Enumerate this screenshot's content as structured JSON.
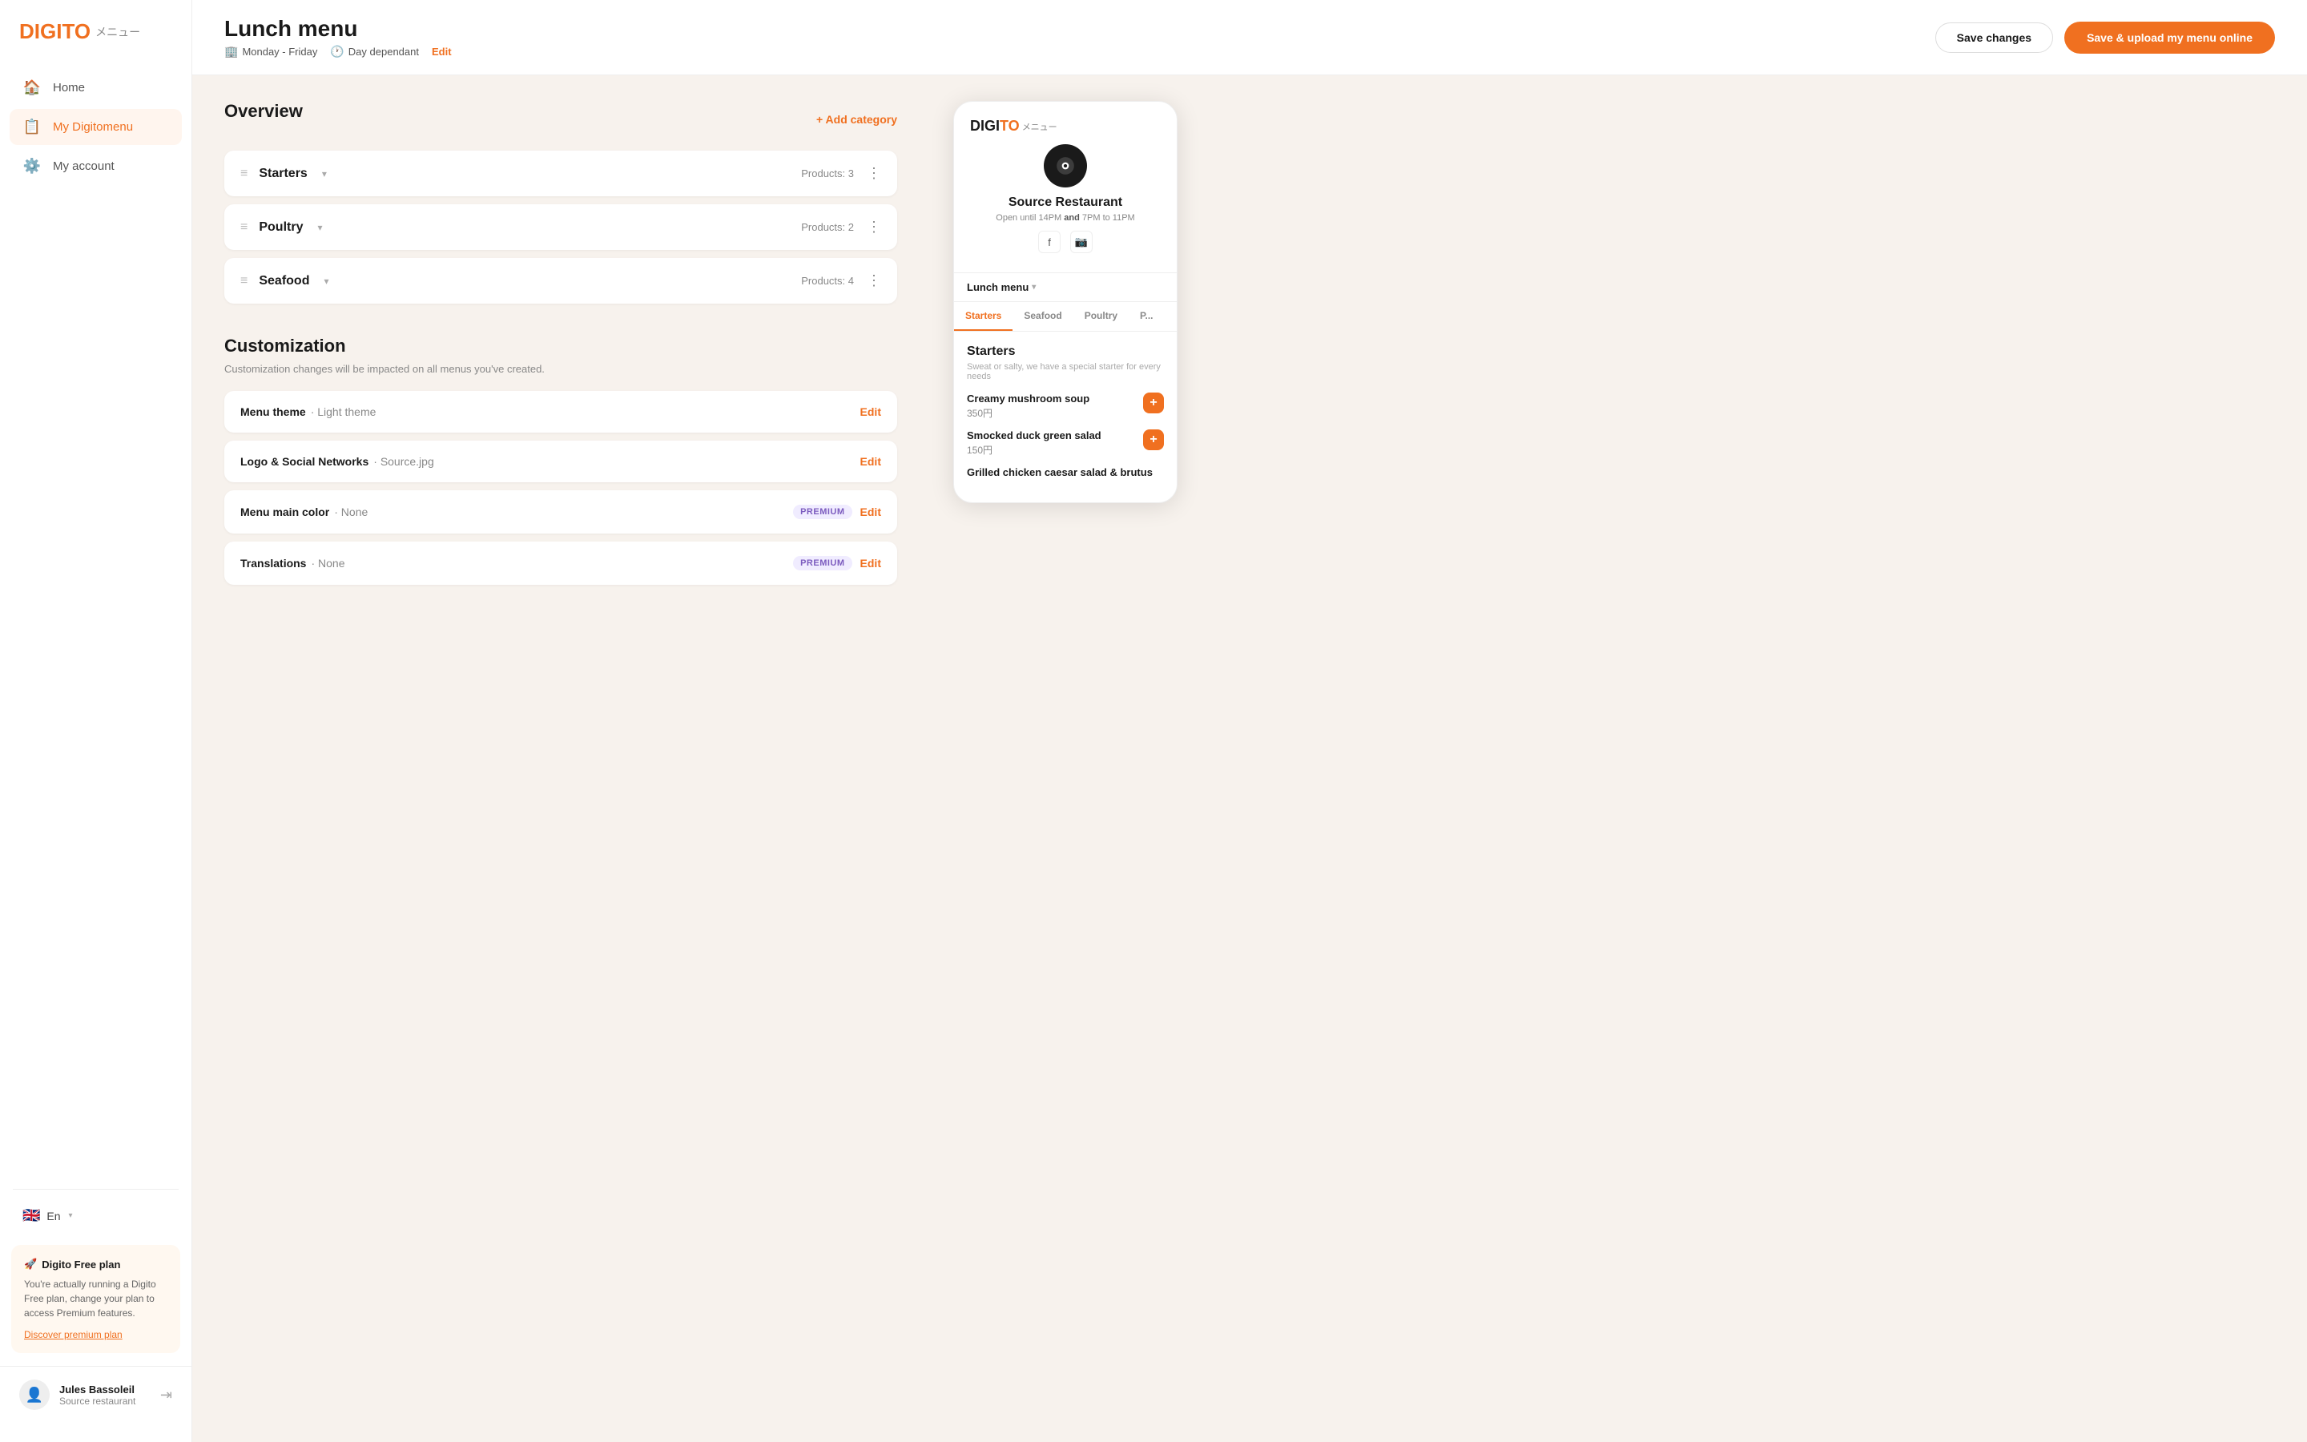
{
  "brand": {
    "name_black": "DIGITO",
    "name_orange": "",
    "name_jp": "メニュー",
    "logo_text": "DIGI",
    "logo_orange": "TO"
  },
  "sidebar": {
    "nav_items": [
      {
        "id": "home",
        "label": "Home",
        "icon": "🏠",
        "active": false
      },
      {
        "id": "my-digitomenu",
        "label": "My Digitomenu",
        "icon": "📋",
        "active": true
      },
      {
        "id": "my-account",
        "label": "My account",
        "icon": "⚙️",
        "active": false
      }
    ],
    "language": {
      "flag": "🇬🇧",
      "label": "En",
      "chevron": "▾"
    },
    "promo": {
      "emoji": "🚀",
      "title": "Digito Free plan",
      "description": "You're actually running a Digito Free plan, change your plan to access Premium features.",
      "link_text": "Discover premium plan"
    },
    "user": {
      "name": "Jules Bassoleil",
      "restaurant": "Source restaurant",
      "avatar_icon": "👤",
      "logout_icon": "→"
    }
  },
  "header": {
    "menu_title": "Lunch menu",
    "meta_schedule": "Monday - Friday",
    "meta_schedule_icon": "🏢",
    "meta_timing": "Day dependant",
    "meta_timing_icon": "🕐",
    "edit_label": "Edit",
    "save_changes_label": "Save changes",
    "save_upload_label": "Save & upload my menu online"
  },
  "overview": {
    "title": "Overview",
    "add_category_label": "+ Add category",
    "categories": [
      {
        "id": "starters",
        "name": "Starters",
        "products_count": "Products: 3"
      },
      {
        "id": "poultry",
        "name": "Poultry",
        "products_count": "Products: 2"
      },
      {
        "id": "seafood",
        "name": "Seafood",
        "products_count": "Products: 4"
      }
    ]
  },
  "customization": {
    "title": "Customization",
    "subtitle": "Customization changes will be impacted on all menus you've created.",
    "rows": [
      {
        "id": "menu-theme",
        "label": "Menu theme",
        "value": "Light theme",
        "premium": false,
        "edit": "Edit"
      },
      {
        "id": "logo-social",
        "label": "Logo & Social Networks",
        "value": "Source.jpg",
        "premium": false,
        "edit": "Edit"
      },
      {
        "id": "menu-color",
        "label": "Menu main color",
        "value": "None",
        "premium": true,
        "edit": "Edit"
      },
      {
        "id": "translations",
        "label": "Translations",
        "value": "None",
        "premium": true,
        "edit": "Edit"
      }
    ],
    "premium_badge": "PREMIUM",
    "dot": "·"
  },
  "preview": {
    "logo_black": "DIGI",
    "logo_orange": "TO",
    "logo_jp": "メニュー",
    "restaurant_name": "Source Restaurant",
    "hours_text": "Open until 14PM",
    "hours_and": "and",
    "hours_text2": "7PM to 11PM",
    "menu_selector": "Lunch menu",
    "tabs": [
      {
        "label": "Starters",
        "active": true
      },
      {
        "label": "Seafood",
        "active": false
      },
      {
        "label": "Poultry",
        "active": false
      },
      {
        "label": "P...",
        "active": false
      }
    ],
    "category_title": "Starters",
    "category_desc": "Sweat or salty, we have a special starter for every needs",
    "menu_items": [
      {
        "name": "Creamy mushroom soup",
        "price": "350円"
      },
      {
        "name": "Smocked duck green salad",
        "price": "150円"
      },
      {
        "name": "Grilled chicken caesar salad & brutus",
        "price": ""
      }
    ]
  }
}
